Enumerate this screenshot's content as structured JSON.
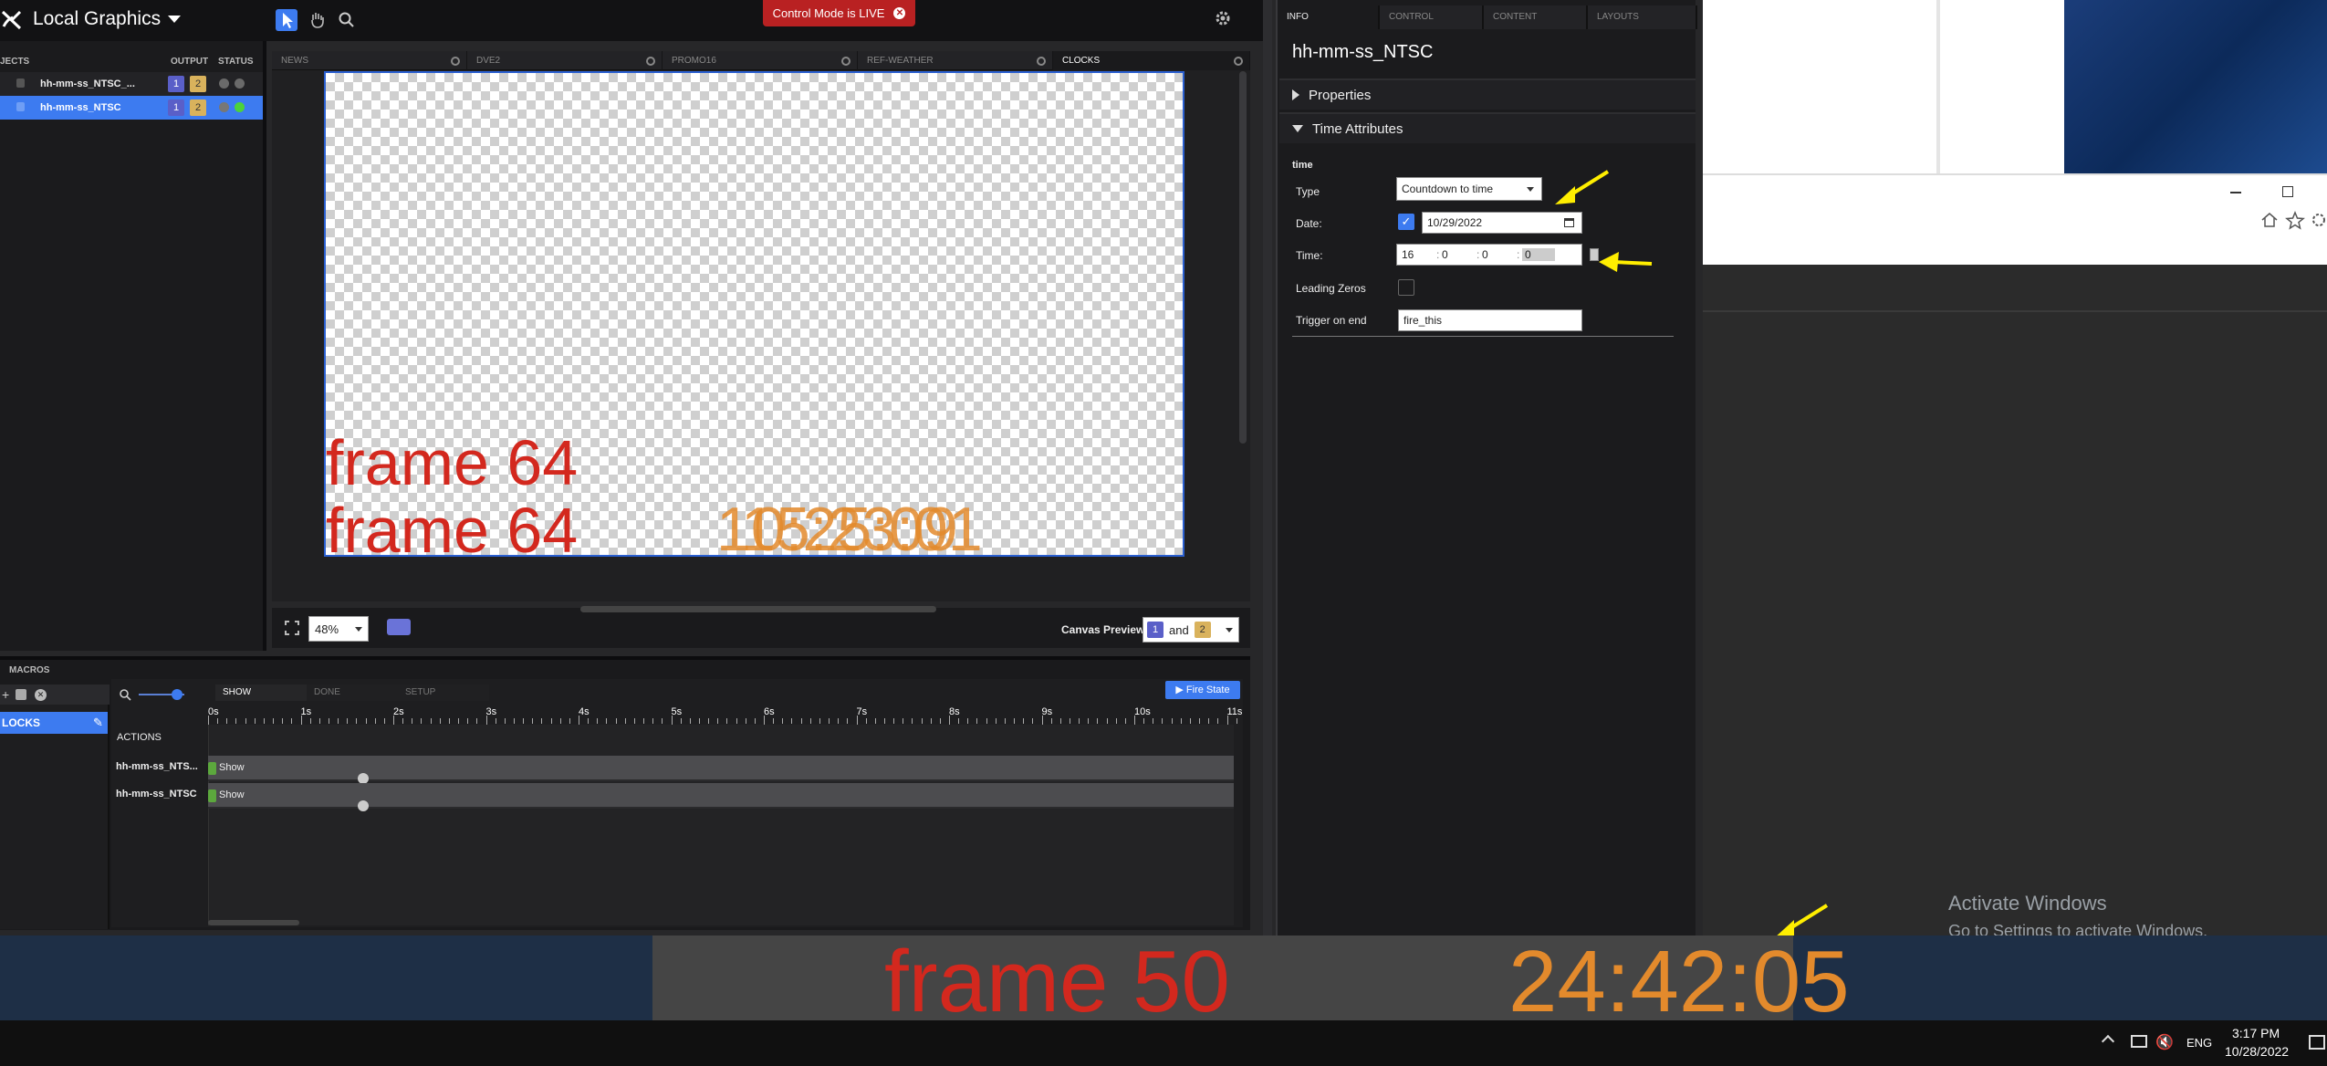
{
  "app": {
    "title": "Local Graphics",
    "live_banner": "Control Mode is LIVE"
  },
  "objects_panel": {
    "headers": {
      "objects": "JECTS",
      "output": "OUTPUT",
      "status": "STATUS"
    },
    "rows": [
      {
        "name": "hh-mm-ss_NTSC_...",
        "out1": "1",
        "out2": "2",
        "selected": false
      },
      {
        "name": "hh-mm-ss_NTSC",
        "out1": "1",
        "out2": "2",
        "selected": true
      }
    ]
  },
  "canvas_tabs": [
    "NEWS",
    "DVE2",
    "PROMO16",
    "REF-WEATHER",
    "CLOCKS"
  ],
  "canvas": {
    "line1": "frame 64",
    "line2": "frame 64",
    "clock_overlay_a": "10:25:09",
    "clock_overlay_b": "15:23:01",
    "zoom": "48%",
    "preview_label": "Canvas Preview",
    "preview_a": "1",
    "preview_and": "and",
    "preview_b": "2"
  },
  "macros": {
    "title": "MACROS",
    "macro_item": "LOCKS",
    "timeline_tabs": [
      "SHOW",
      "DONE",
      "SETUP"
    ],
    "fire_state": "▶ Fire State",
    "actions_label": "ACTIONS",
    "ticks": [
      "0s",
      "1s",
      "2s",
      "3s",
      "4s",
      "5s",
      "6s",
      "7s",
      "8s",
      "9s",
      "10s",
      "11s"
    ],
    "rows": [
      {
        "label": "hh-mm-ss_NTS...",
        "cue": "Show"
      },
      {
        "label": "hh-mm-ss_NTSC",
        "cue": "Show"
      }
    ]
  },
  "props": {
    "tabs": [
      "INFO",
      "CONTROL",
      "CONTENT",
      "LAYOUTS"
    ],
    "object_name": "hh-mm-ss_NTSC",
    "sections": {
      "properties": "Properties",
      "time_attributes": "Time Attributes"
    },
    "group": "time",
    "type_label": "Type",
    "type_value": "Countdown to time",
    "date_label": "Date:",
    "date_value": "10/29/2022",
    "time_label": "Time:",
    "time_h": "16",
    "time_m": "0",
    "time_s": "0",
    "time_f": "0",
    "leading_zeros_label": "Leading Zeros",
    "trigger_label": "Trigger on end",
    "trigger_value": "fire_this"
  },
  "output": {
    "frame": "frame 50",
    "clock": "24:42:05"
  },
  "windows": {
    "activate": "Activate Windows",
    "activate_sub": "Go to Settings to activate Windows."
  },
  "taskbar": {
    "lang": "ENG",
    "time": "3:17 PM",
    "date": "10/28/2022"
  },
  "colors": {
    "accent": "#3d7bf0",
    "frame_red": "#d3281e",
    "clock_orange": "#e38a2c",
    "live_red": "#b92122",
    "arrow_yellow": "#ffee00"
  }
}
